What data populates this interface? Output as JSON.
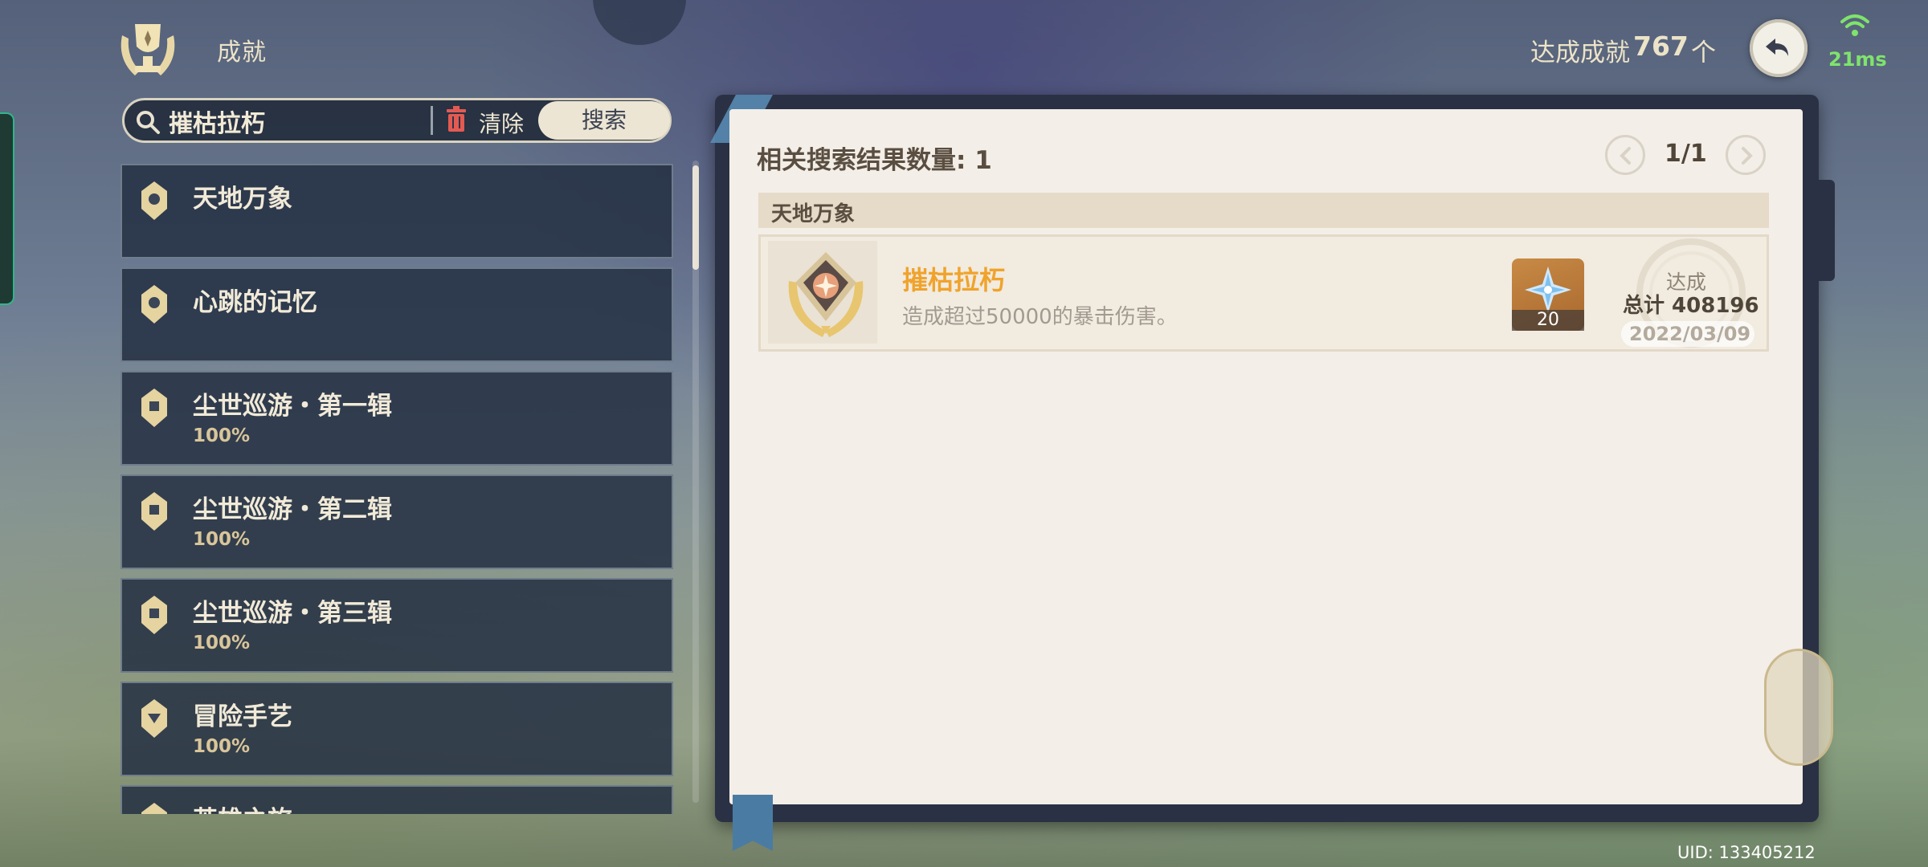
{
  "header": {
    "title": "成就",
    "achieved_label": "达成成就",
    "achieved_count": "767",
    "achieved_unit": "个",
    "ping": "21ms"
  },
  "search": {
    "value": "摧枯拉朽",
    "clear_label": "清除",
    "search_label": "搜索"
  },
  "categories": [
    {
      "name": "天地万象",
      "progress": ""
    },
    {
      "name": "心跳的记忆",
      "progress": ""
    },
    {
      "name": "尘世巡游・第一辑",
      "progress": "100%"
    },
    {
      "name": "尘世巡游・第二辑",
      "progress": "100%"
    },
    {
      "name": "尘世巡游・第三辑",
      "progress": "100%"
    },
    {
      "name": "冒险手艺",
      "progress": "100%"
    },
    {
      "name": "英雄之旅",
      "progress": ""
    }
  ],
  "results": {
    "count_label": "相关搜索结果数量: 1",
    "page": "1/1",
    "group_title": "天地万象",
    "achievement": {
      "name": "摧枯拉朽",
      "description": "造成超过50000的暴击伤害。",
      "reward_qty": "20",
      "stamp_label": "达成",
      "stamp_total": "总计 408196",
      "date": "2022/03/09"
    }
  },
  "footer": {
    "uid": "UID: 133405212"
  },
  "colors": {
    "accent": "#f0a32c",
    "panel_bg": "#f3eee7",
    "list_bg": "#243042",
    "ping": "#7fe36c"
  },
  "icons": {
    "trophy": "trophy-emblem-icon",
    "back": "back-arrow-icon",
    "wifi": "wifi-icon",
    "search": "search-icon",
    "trash": "trash-icon",
    "prev": "chevron-left-icon",
    "next": "chevron-right-icon",
    "gem": "primogem-icon"
  }
}
